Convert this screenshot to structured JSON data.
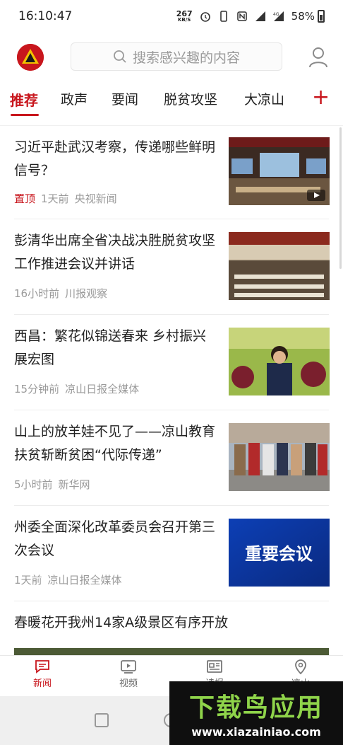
{
  "status_bar": {
    "time": "16:10:47",
    "net_speed": "267",
    "net_unit": "KB/S",
    "network_type": "4G",
    "battery": "58%"
  },
  "header": {
    "logo_icon": "party-emblem-logo",
    "search_placeholder": "搜索感兴趣的内容",
    "user_icon": "user-profile-icon"
  },
  "tabs": [
    {
      "label": "推荐",
      "active": true
    },
    {
      "label": "政声"
    },
    {
      "label": "要闻"
    },
    {
      "label": "脱贫攻坚"
    },
    {
      "label": "大凉山"
    }
  ],
  "add_tab_symbol": "+",
  "accent_color": "#c8161d",
  "news": [
    {
      "title": "习近平赴武汉考察，传递哪些鲜明信号？",
      "pin": "置顶",
      "time": "1天前",
      "source": "央视新闻",
      "thumb": "video-meeting-hall",
      "has_video": true
    },
    {
      "title": "彭清华出席全省决战决胜脱贫攻坚工作推进会议并讲话",
      "time": "16小时前",
      "source": "川报观察",
      "thumb": "conference-hall"
    },
    {
      "title": "西昌：繁花似锦送春来 乡村振兴展宏图",
      "time": "15分钟前",
      "source": "凉山日报全媒体",
      "thumb": "woman-with-grapes"
    },
    {
      "title": "山上的放羊娃不见了——凉山教育扶贫斩断贫困“代际传递”",
      "time": "5小时前",
      "source": "新华网",
      "thumb": "students-group"
    },
    {
      "title": "州委全面深化改革委员会召开第三次会议",
      "time": "1天前",
      "source": "凉山日报全媒体",
      "thumb": "important-meeting-banner",
      "thumb_text": "重要会议"
    },
    {
      "title": "春暖花开我州14家A级景区有序开放"
    }
  ],
  "bottom_nav": [
    {
      "label": "新闻",
      "icon": "news-chat-icon",
      "active": true
    },
    {
      "label": "视频",
      "icon": "video-icon"
    },
    {
      "label": "读报",
      "icon": "newspaper-icon"
    },
    {
      "label": "凉山",
      "icon": "location-pin-icon"
    }
  ],
  "watermark": {
    "title": "下载鸟应用",
    "url": "www.xiazainiao.com"
  }
}
